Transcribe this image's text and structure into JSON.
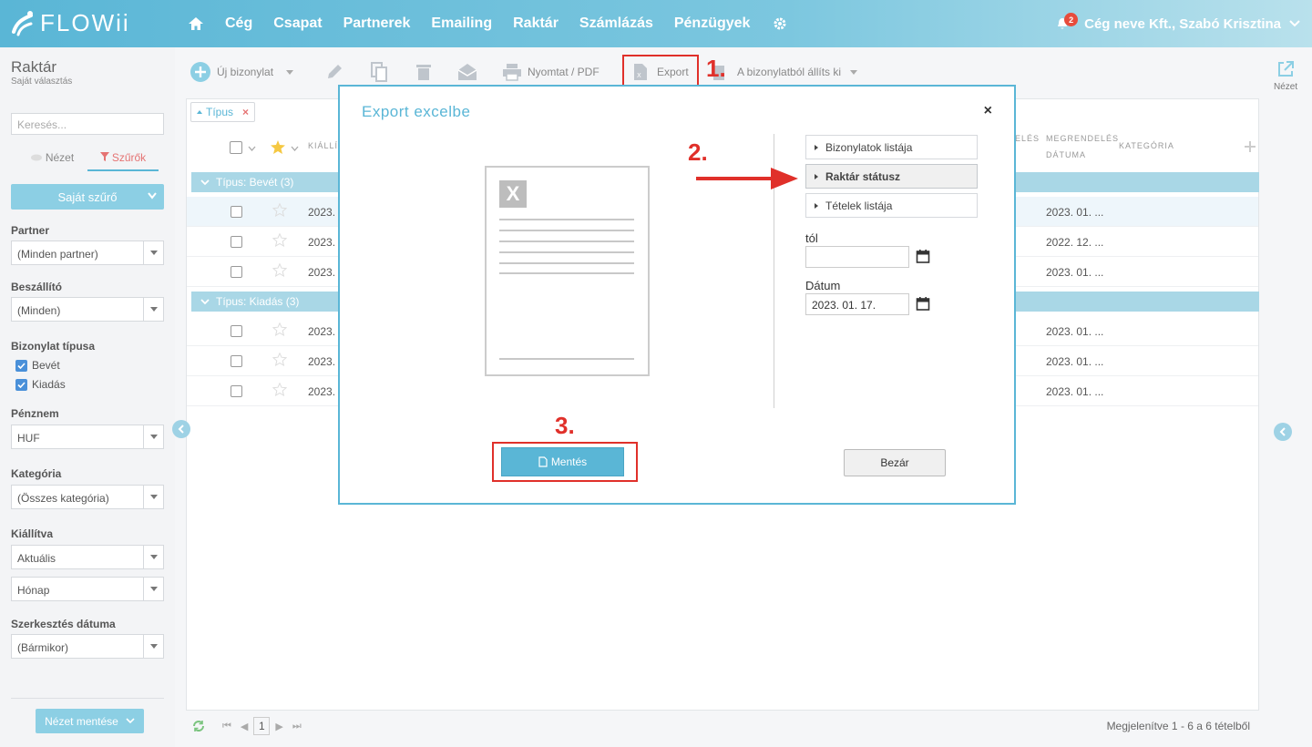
{
  "brand": {
    "name": "FLOWii"
  },
  "nav": {
    "items": [
      "Cég",
      "Csapat",
      "Partnerek",
      "Emailing",
      "Raktár",
      "Számlázás",
      "Pénzügyek"
    ],
    "notification_count": "2",
    "user": "Cég neve Kft., Szabó Krisztina"
  },
  "sidebar": {
    "title": "Raktár",
    "subtitle": "Saját választás",
    "search_placeholder": "Keresés...",
    "tab_view": "Nézet",
    "tab_filters": "Szűrők",
    "own_filter": "Saját szűrő",
    "partner_label": "Partner",
    "partner_value": "(Minden partner)",
    "supplier_label": "Beszállító",
    "supplier_value": "(Minden)",
    "doctype_label": "Bizonylat típusa",
    "doctype_in": "Bevét",
    "doctype_out": "Kiadás",
    "currency_label": "Pénznem",
    "currency_value": "HUF",
    "category_label": "Kategória",
    "category_value": "(Összes kategória)",
    "issued_label": "Kiállítva",
    "issued_value": "Aktuális",
    "issued_period": "Hónap",
    "edit_date_label": "Szerkesztés dátuma",
    "edit_date_value": "(Bármikor)",
    "save_view": "Nézet mentése"
  },
  "toolbar": {
    "new_doc": "Új bizonylat",
    "print": "Nyomtat / PDF",
    "export": "Export",
    "create_from": "A bizonylatból állíts ki",
    "view": "Nézet"
  },
  "steps": {
    "s1": "1.",
    "s2": "2.",
    "s3": "3."
  },
  "table": {
    "filter_chip": "Típus",
    "col_issued": "KIÁLLÍ",
    "col_order_frag": "ELÉS",
    "col_order_date_1": "MEGRENDELÉS",
    "col_order_date_2": "DÁTUMA",
    "col_category": "KATEGÓRIA",
    "group_in": "Típus: Bevét (3)",
    "group_out": "Típus: Kiadás (3)",
    "rows_in": [
      {
        "issued": "2023.",
        "order_date": "2023. 01. ..."
      },
      {
        "issued": "2023.",
        "order_date": "2022. 12. ..."
      },
      {
        "issued": "2023.",
        "order_date": "2023. 01. ..."
      }
    ],
    "rows_out": [
      {
        "issued": "2023.",
        "order_date": "2023. 01. ..."
      },
      {
        "issued": "2023.",
        "order_date": "2023. 01. ..."
      },
      {
        "issued": "2023.",
        "order_date": "2023. 01. ..."
      }
    ],
    "page": "1",
    "summary": "Megjelenítve 1 - 6 a 6 tételből"
  },
  "modal": {
    "title": "Export excelbe",
    "close": "×",
    "options": [
      "Bizonylatok listája",
      "Raktár státusz",
      "Tételek listája"
    ],
    "from_label": "tól",
    "from_value": "",
    "date_label": "Dátum",
    "date_value": "2023. 01. 17.",
    "save": "Mentés",
    "close_button": "Bezár"
  },
  "colors": {
    "accent": "#5ab6d6",
    "annotation": "#e0302a"
  }
}
